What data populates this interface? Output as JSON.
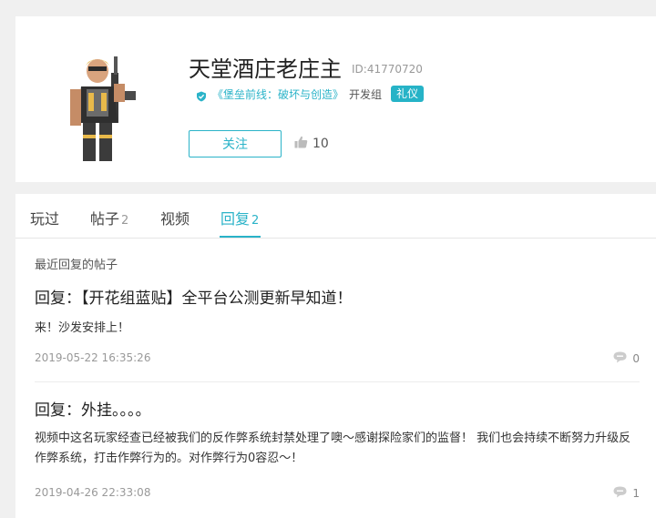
{
  "profile": {
    "username": "天堂酒庄老庄主",
    "user_id": "ID:41770720",
    "team_name": "《堡垒前线：破坏与创造》",
    "team_suffix": "开发组",
    "badge": "礼仪",
    "follow_label": "关注",
    "likes": "10"
  },
  "tabs": [
    {
      "label": "玩过",
      "count": ""
    },
    {
      "label": "帖子",
      "count": "2"
    },
    {
      "label": "视频",
      "count": ""
    },
    {
      "label": "回复",
      "count": "2"
    }
  ],
  "active_tab_index": 3,
  "section_label": "最近回复的帖子",
  "posts": [
    {
      "title": "回复：【开花组蓝贴】全平台公测更新早知道！",
      "body": "来！沙发安排上！",
      "date": "2019-05-22 16:35:26",
      "comments": "0"
    },
    {
      "title": "回复：外挂。。。。",
      "body": "视频中这名玩家经查已经被我们的反作弊系统封禁处理了噢～感谢探险家们的监督！ 我们也会持续不断努力升级反作弊系统，打击作弊行为的。对作弊行为0容忍～！",
      "date": "2019-04-26 22:33:08",
      "comments": "1"
    }
  ],
  "colors": {
    "accent": "#2ab3c8",
    "page_bg": "#f0f0f0",
    "card_bg": "#ffffff"
  },
  "icons": {
    "verified": "verified-check-icon",
    "like": "thumbs-up-icon",
    "comment": "comment-bubble-icon"
  }
}
